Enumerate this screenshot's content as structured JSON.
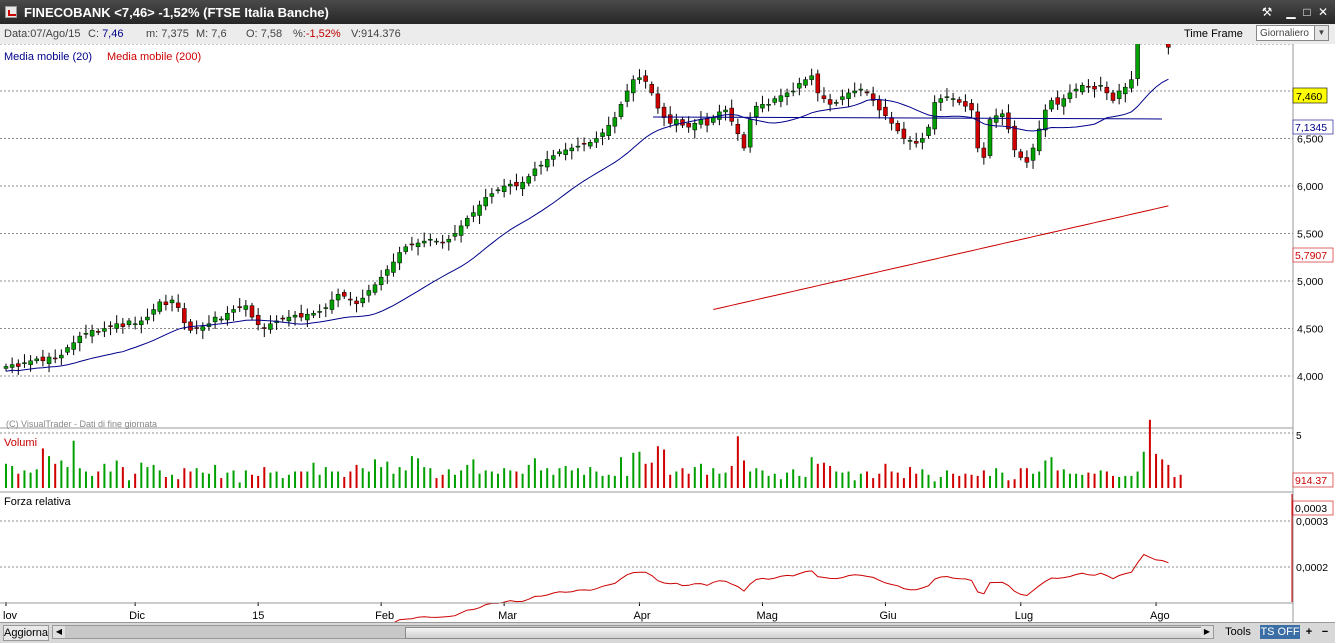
{
  "window": {
    "title": "FINECOBANK <7,46> -1,52%  (FTSE Italia Banche)",
    "icons": [
      "chart-app-icon",
      "pin-icon",
      "minimize-icon",
      "restore-icon",
      "close-icon"
    ]
  },
  "info": {
    "date_label": "Data:",
    "date": "07/Ago/15",
    "close_label": "C:",
    "close": "7,46",
    "min_label": "m:",
    "min": "7,375",
    "max_label": "M:",
    "max": "7,6",
    "open_label": "O:",
    "open": "7,58",
    "pct_label": "%:",
    "pct": "-1,52%",
    "vol_label": "V:",
    "vol": "914.376",
    "timeframe_label": "Time Frame",
    "timeframe_value": "Giornaliero"
  },
  "legend": {
    "ma20": "Media mobile (20)",
    "ma200": "Media mobile (200)",
    "watermark": "(C) VisualTrader - Dati di fine giornata"
  },
  "panels": {
    "volume_label": "Volumi",
    "volume_axis_top": "5",
    "volume_last": "914.37",
    "rs_label": "Forza relativa",
    "rs_ticks": [
      "0,0003",
      "0,0002"
    ],
    "rs_last": "0,0003"
  },
  "tags": {
    "last_price": "7,460",
    "ma20_value": "7,1345",
    "ma200_value": "5,7907"
  },
  "colors": {
    "up_candle": "#00a000",
    "down_candle": "#d00000",
    "ma20": "#00008b",
    "ma200": "#cc0000",
    "last_tag": "#ffff00"
  },
  "toolbar": {
    "refresh": "Aggiorna",
    "tools": "Tools",
    "ts": "TS OFF",
    "plus": "+",
    "minus": "−"
  },
  "chart_data": {
    "type": "candlestick",
    "price_ticks": [
      "7,000",
      "6,500",
      "6,000",
      "5,500",
      "5,000",
      "4,500",
      "4,000"
    ],
    "price_tick_values": [
      7,
      6.5,
      6,
      5.5,
      5,
      4.5,
      4
    ],
    "ylim": [
      3.985,
      7.6
    ],
    "x_labels": [
      "lov",
      "Dic",
      "15",
      "Feb",
      "Mar",
      "Apr",
      "Mag",
      "Giu",
      "Lug",
      "Ago"
    ],
    "x_label_positions": [
      0,
      21,
      41,
      61,
      81,
      103,
      123,
      143,
      165,
      187
    ],
    "close": [
      4.1,
      4.12,
      4.1,
      4.14,
      4.16,
      4.18,
      4.16,
      4.2,
      4.18,
      4.22,
      4.3,
      4.35,
      4.42,
      4.45,
      4.48,
      4.46,
      4.5,
      4.52,
      4.55,
      4.52,
      4.58,
      4.55,
      4.58,
      4.62,
      4.7,
      4.78,
      4.75,
      4.8,
      4.72,
      4.56,
      4.48,
      4.5,
      4.52,
      4.55,
      4.62,
      4.6,
      4.66,
      4.7,
      4.72,
      4.74,
      4.62,
      4.54,
      4.5,
      4.55,
      4.58,
      4.6,
      4.62,
      4.64,
      4.62,
      4.65,
      4.66,
      4.68,
      4.72,
      4.8,
      4.86,
      4.84,
      4.8,
      4.76,
      4.82,
      4.9,
      4.96,
      5.04,
      5.12,
      5.2,
      5.3,
      5.36,
      5.38,
      5.4,
      5.42,
      5.44,
      5.42,
      5.4,
      5.44,
      5.5,
      5.58,
      5.66,
      5.72,
      5.8,
      5.88,
      5.92,
      5.96,
      6.0,
      6.02,
      6.0,
      6.04,
      6.1,
      6.18,
      6.22,
      6.28,
      6.32,
      6.36,
      6.38,
      6.4,
      6.42,
      6.44,
      6.46,
      6.5,
      6.56,
      6.64,
      6.72,
      6.86,
      7.0,
      7.12,
      7.14,
      7.1,
      6.98,
      6.82,
      6.72,
      6.66,
      6.7,
      6.64,
      6.62,
      6.66,
      6.7,
      6.64,
      6.72,
      6.78,
      6.8,
      6.68,
      6.55,
      6.4,
      6.7,
      6.84,
      6.86,
      6.86,
      6.92,
      6.95,
      6.98,
      7.0,
      7.08,
      7.12,
      7.16,
      6.98,
      6.92,
      6.86,
      6.88,
      6.94,
      6.98,
      7.0,
      7.02,
      6.98,
      6.9,
      6.8,
      6.74,
      6.66,
      6.58,
      6.5,
      6.48,
      6.45,
      6.5,
      6.62,
      6.88,
      6.92,
      6.94,
      6.92,
      6.88,
      6.84,
      6.8,
      6.4,
      6.3,
      6.7,
      6.74,
      6.76,
      6.6,
      6.38,
      6.3,
      6.25,
      6.4,
      6.6,
      6.8,
      6.9,
      6.86,
      6.92,
      6.98,
      7.02,
      7.06,
      7.04,
      7.02,
      7.06,
      6.98,
      6.9,
      7.0,
      7.04,
      7.12,
      7.5,
      7.78,
      7.66,
      7.6,
      7.58,
      7.46
    ],
    "volume": [
      2.2,
      2,
      1.3,
      1.6,
      1.4,
      1.7,
      3.6,
      2.9,
      2.2,
      2.5,
      1.9,
      4.3,
      1.8,
      1.5,
      1.1,
      1.5,
      2.2,
      1.5,
      2.5,
      1.9,
      0.7,
      1.3,
      2.3,
      1.9,
      2.1,
      1.6,
      1,
      1.2,
      0.8,
      1.8,
      1.5,
      1.8,
      1.4,
      1.3,
      2.1,
      0.9,
      1.4,
      1.6,
      0.5,
      1.6,
      1.2,
      1.1,
      1.9,
      1.4,
      1.5,
      0.9,
      1.2,
      1.5,
      1.5,
      1.5,
      2.3,
      1.2,
      1.9,
      1.5,
      1.5,
      1,
      1.5,
      2.1,
      1.8,
      1.5,
      2.6,
      1.9,
      2.4,
      1.3,
      1.9,
      1.6,
      2.9,
      2.7,
      1.9,
      1.8,
      0.9,
      1.2,
      1.7,
      1.2,
      1.6,
      2.1,
      2.6,
      1.3,
      1.6,
      1.5,
      1.3,
      1.8,
      1.6,
      1.5,
      1.3,
      2.1,
      2.7,
      1.6,
      1.8,
      1.2,
      1.8,
      2,
      1.6,
      1.8,
      1.2,
      1.9,
      1.5,
      1.1,
      1.2,
      1.1,
      2.8,
      1.1,
      3.2,
      3.3,
      2.2,
      2.3,
      3.8,
      3.5,
      1.2,
      1.5,
      1.8,
      1.3,
      1.9,
      2.2,
      1.2,
      1.8,
      1.3,
      1.4,
      2,
      4.7,
      2.5,
      1.5,
      1.8,
      1.6,
      1.1,
      1.3,
      0.8,
      1.4,
      1.7,
      1.1,
      1,
      2.8,
      2.2,
      2.3,
      2,
      1.5,
      1.4,
      1.5,
      0.7,
      1.3,
      1.5,
      0.9,
      1.3,
      2.2,
      1.5,
      1.4,
      0.9,
      1.9,
      1.3,
      1.7,
      1.2,
      0.6,
      1,
      1.6,
      1.3,
      1.1,
      1.3,
      1.2,
      1.1,
      1.6,
      1.1,
      1.8,
      1.4,
      0.7,
      0.8,
      1.8,
      1.8,
      1.3,
      1.5,
      2.5,
      2.8,
      1.6,
      1.7,
      1.3,
      1.3,
      1.2,
      1.4,
      1.3,
      1.6,
      1.5,
      1.1,
      1,
      1.1,
      1.1,
      1.5,
      3.3,
      6.2,
      3.1,
      2.6,
      2.1,
      1,
      1.2
    ],
    "rs_scale": "0,0002 at 567px, 0,0003 at 521px"
  }
}
